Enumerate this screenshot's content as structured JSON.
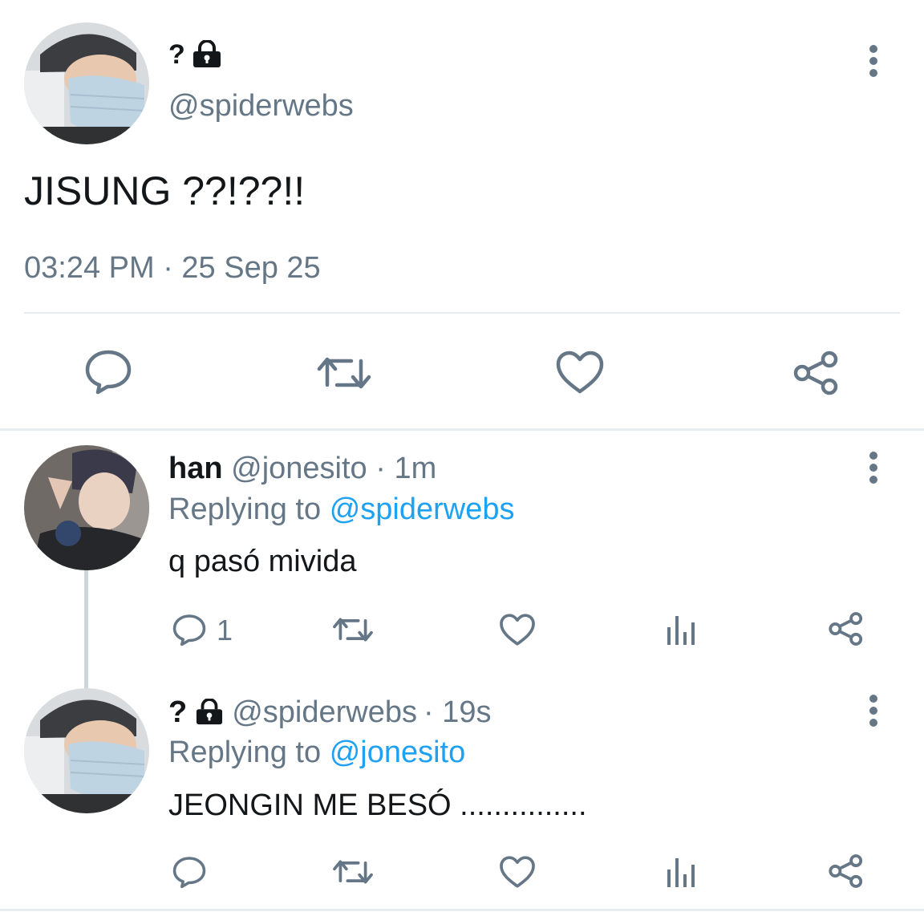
{
  "main_tweet": {
    "display_name": "?",
    "handle": "@spiderwebs",
    "text": "JISUNG ??!??!!",
    "timestamp": "03:24 PM · 25 Sep 25",
    "locked": true
  },
  "replies": [
    {
      "display_name": "han",
      "handle": "@jonesito",
      "time": "· 1m",
      "replying_label": "Replying to",
      "replying_to": "@spiderwebs",
      "text": "q pasó mivida",
      "reply_count": "1",
      "locked": false
    },
    {
      "display_name": "?",
      "handle": "@spiderwebs",
      "time": "· 19s",
      "replying_label": "Replying to",
      "replying_to": "@jonesito",
      "text": "JEONGIN ME BESÓ ...............",
      "reply_count": "",
      "locked": true
    }
  ],
  "colors": {
    "text": "#14171a",
    "secondary": "#657786",
    "accent": "#1da1f2",
    "divider": "#e6ecf0"
  },
  "icons": [
    "more-vertical-icon",
    "lock-icon",
    "reply-icon",
    "retweet-icon",
    "like-icon",
    "share-icon",
    "analytics-icon"
  ]
}
